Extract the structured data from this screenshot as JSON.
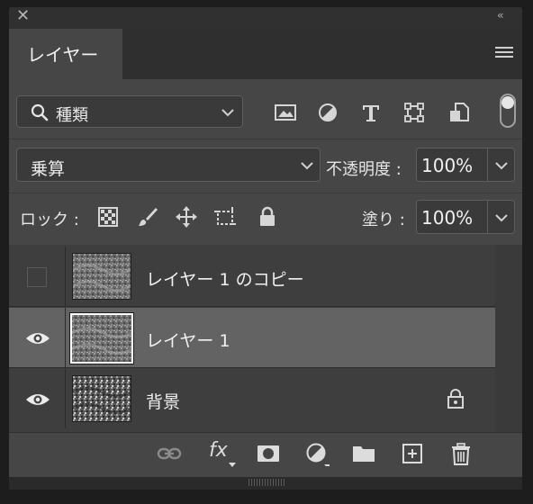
{
  "panel": {
    "title_tab": "レイヤー",
    "close_symbol": "✕",
    "collapse_symbol": "‹‹",
    "icons": {
      "close": "close-icon",
      "collapse": "double-chevron-left-icon",
      "menu": "hamburger-menu-icon"
    }
  },
  "filter": {
    "label": "種類",
    "icons": [
      "image-filter-icon",
      "adjustment-filter-icon",
      "type-filter-icon",
      "shape-filter-icon",
      "smart-object-filter-icon"
    ]
  },
  "blend": {
    "mode": "乗算",
    "opacity_label": "不透明度 :",
    "opacity_value": "100%"
  },
  "lock": {
    "label": "ロック :",
    "icons": [
      "lock-transparency-icon",
      "lock-pixels-icon",
      "lock-position-icon",
      "lock-artboard-icon",
      "lock-all-icon"
    ],
    "fill_label": "塗り :",
    "fill_value": "100%"
  },
  "layers": [
    {
      "name": "レイヤー 1 のコピー",
      "visible": false,
      "selected": false,
      "locked": false
    },
    {
      "name": "レイヤー 1",
      "visible": true,
      "selected": true,
      "locked": false
    },
    {
      "name": "背景",
      "visible": true,
      "selected": false,
      "locked": true
    }
  ],
  "bottom_icons": [
    "link-layers-icon",
    "layer-style-fx-icon",
    "add-mask-icon",
    "adjustment-layer-icon",
    "new-group-icon",
    "new-layer-icon",
    "delete-layer-icon"
  ],
  "fx_text": "fx",
  "colors": {
    "panel": "#464646",
    "selected_row": "#636363",
    "background": "#1d1d1d"
  }
}
